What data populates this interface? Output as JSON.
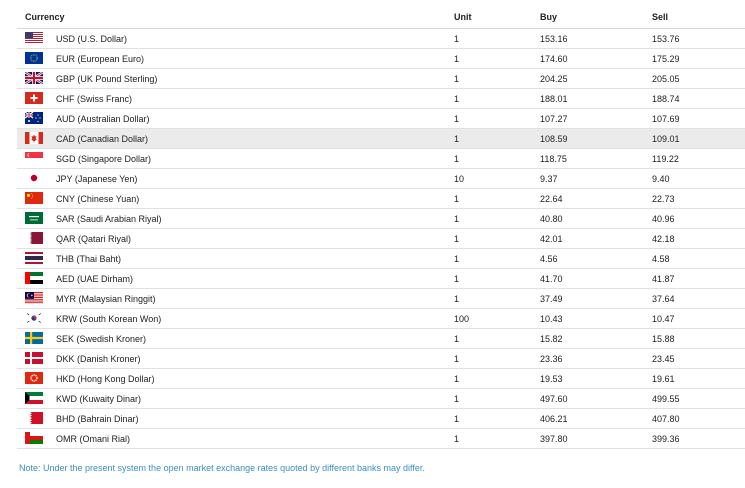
{
  "headers": {
    "currency": "Currency",
    "unit": "Unit",
    "buy": "Buy",
    "sell": "Sell"
  },
  "rows": [
    {
      "name": "USD (U.S. Dollar)",
      "unit": "1",
      "buy": "153.16",
      "sell": "153.76",
      "flag": "us-flag-icon"
    },
    {
      "name": "EUR (European Euro)",
      "unit": "1",
      "buy": "174.60",
      "sell": "175.29",
      "flag": "eu-flag-icon"
    },
    {
      "name": "GBP (UK Pound Sterling)",
      "unit": "1",
      "buy": "204.25",
      "sell": "205.05",
      "flag": "uk-flag-icon"
    },
    {
      "name": "CHF (Swiss Franc)",
      "unit": "1",
      "buy": "188.01",
      "sell": "188.74",
      "flag": "swiss-flag-icon"
    },
    {
      "name": "AUD (Australian Dollar)",
      "unit": "1",
      "buy": "107.27",
      "sell": "107.69",
      "flag": "australia-flag-icon"
    },
    {
      "name": "CAD (Canadian Dollar)",
      "unit": "1",
      "buy": "108.59",
      "sell": "109.01",
      "flag": "canada-flag-icon"
    },
    {
      "name": "SGD (Singapore Dollar)",
      "unit": "1",
      "buy": "118.75",
      "sell": "119.22",
      "flag": "singapore-flag-icon"
    },
    {
      "name": "JPY (Japanese Yen)",
      "unit": "10",
      "buy": "9.37",
      "sell": "9.40",
      "flag": "japan-flag-icon"
    },
    {
      "name": "CNY (Chinese Yuan)",
      "unit": "1",
      "buy": "22.64",
      "sell": "22.73",
      "flag": "china-flag-icon"
    },
    {
      "name": "SAR (Saudi Arabian Riyal)",
      "unit": "1",
      "buy": "40.80",
      "sell": "40.96",
      "flag": "saudi-flag-icon"
    },
    {
      "name": "QAR (Qatari Riyal)",
      "unit": "1",
      "buy": "42.01",
      "sell": "42.18",
      "flag": "qatar-flag-icon"
    },
    {
      "name": "THB (Thai Baht)",
      "unit": "1",
      "buy": "4.56",
      "sell": "4.58",
      "flag": "thailand-flag-icon"
    },
    {
      "name": "AED (UAE Dirham)",
      "unit": "1",
      "buy": "41.70",
      "sell": "41.87",
      "flag": "uae-flag-icon"
    },
    {
      "name": "MYR (Malaysian Ringgit)",
      "unit": "1",
      "buy": "37.49",
      "sell": "37.64",
      "flag": "malaysia-flag-icon"
    },
    {
      "name": "KRW (South Korean Won)",
      "unit": "100",
      "buy": "10.43",
      "sell": "10.47",
      "flag": "korea-flag-icon"
    },
    {
      "name": "SEK (Swedish Kroner)",
      "unit": "1",
      "buy": "15.82",
      "sell": "15.88",
      "flag": "sweden-flag-icon"
    },
    {
      "name": "DKK (Danish Kroner)",
      "unit": "1",
      "buy": "23.36",
      "sell": "23.45",
      "flag": "denmark-flag-icon"
    },
    {
      "name": "HKD (Hong Kong Dollar)",
      "unit": "1",
      "buy": "19.53",
      "sell": "19.61",
      "flag": "hongkong-flag-icon"
    },
    {
      "name": "KWD (Kuwaity Dinar)",
      "unit": "1",
      "buy": "497.60",
      "sell": "499.55",
      "flag": "kuwait-flag-icon"
    },
    {
      "name": "BHD (Bahrain Dinar)",
      "unit": "1",
      "buy": "406.21",
      "sell": "407.80",
      "flag": "bahrain-flag-icon"
    },
    {
      "name": "OMR (Omani Rial)",
      "unit": "1",
      "buy": "397.80",
      "sell": "399.36",
      "flag": "oman-flag-icon"
    }
  ],
  "highlighted_row": "CAD (Canadian Dollar)",
  "note": "Note: Under the present system the open market exchange rates quoted by different banks may differ.",
  "colors": {
    "note": "#3a8fc4",
    "highlight_row": "#ebebeb"
  }
}
